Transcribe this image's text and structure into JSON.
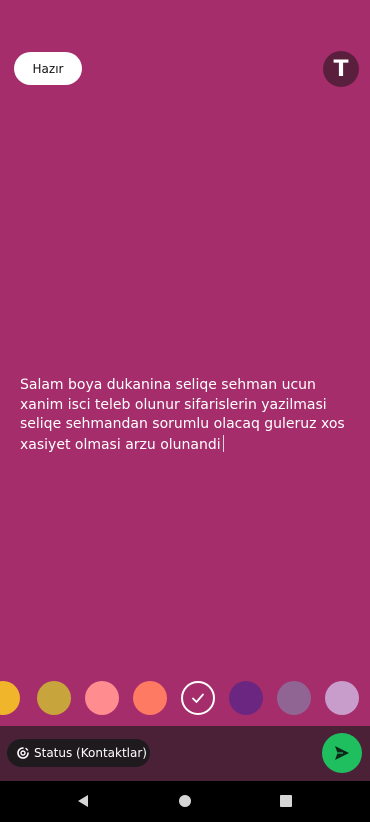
{
  "top_bar": {
    "done_label": "Hazır",
    "font_button_label": "T"
  },
  "status": {
    "text": "Salam boya dukanina seliqe sehman ucun xanim isci teleb olunur sifarislerin yazilmasi seliqe sehmandan sorumlu olacaq guleruz xos xasiyet olmasi arzu olunandi"
  },
  "colors": {
    "background": "#a62d6b",
    "palette": [
      "#f0b52a",
      "#c8a43c",
      "#ff8c8f",
      "#ff7a63",
      "#a62d6b",
      "#6a2680",
      "#916593",
      "#c99dcb"
    ],
    "selected_index": 4,
    "send_button": "#1fbf60"
  },
  "footer": {
    "audience_label": "Status (Kontaktlar)",
    "send_icon": "send-icon"
  },
  "nav": {
    "back_icon": "back-icon",
    "home_icon": "home-icon",
    "recents_icon": "recents-icon"
  }
}
